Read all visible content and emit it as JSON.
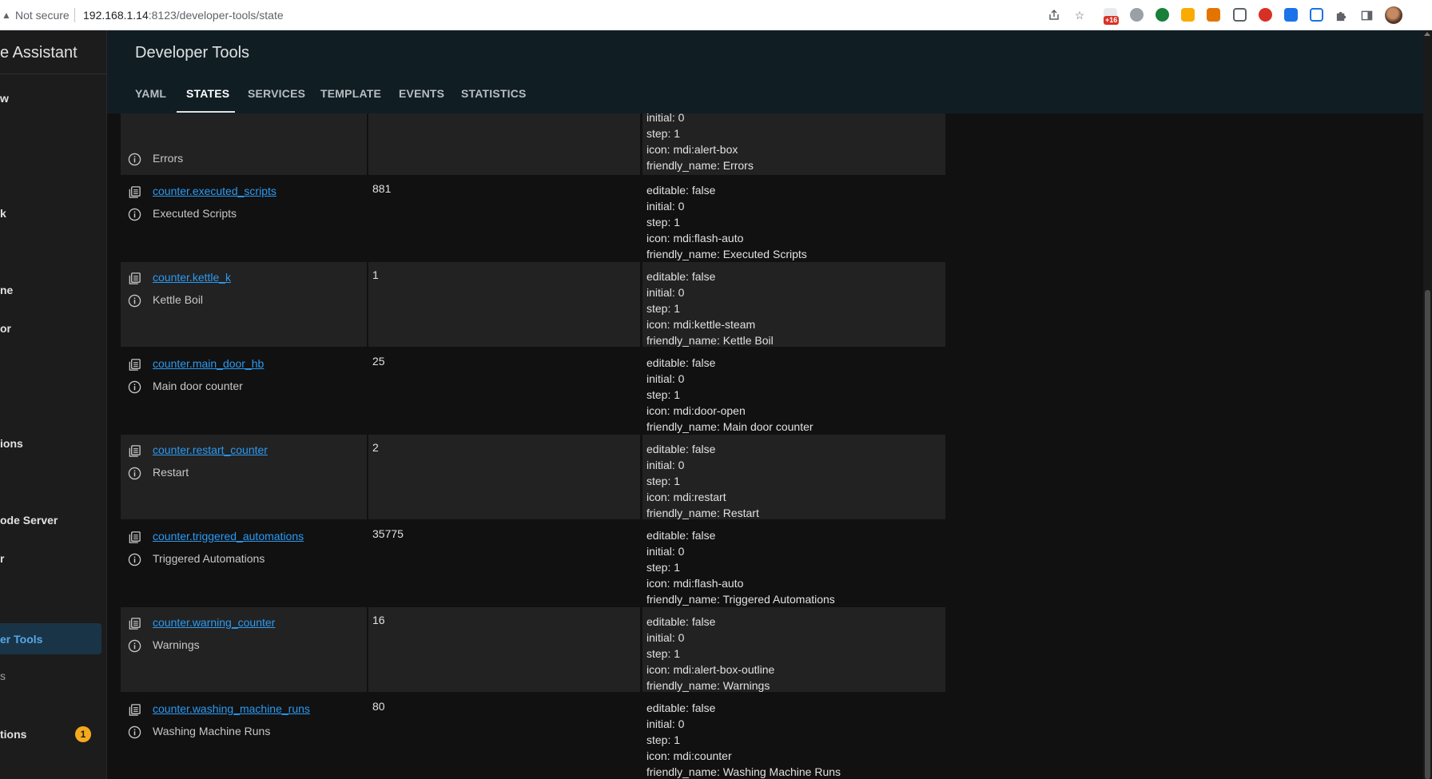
{
  "browser": {
    "security_label": "Not secure",
    "url_host": "192.168.1.14",
    "url_rest": ":8123/developer-tools/state",
    "ext_badge": "+16"
  },
  "sidebar": {
    "title": "e Assistant",
    "items": [
      "w",
      "k",
      "ne",
      "or",
      "ions",
      "ode Server",
      "r",
      "s",
      "tions"
    ],
    "active_label": "er Tools",
    "badge": "1"
  },
  "header": {
    "title": "Developer Tools",
    "tabs": [
      "YAML",
      "STATES",
      "SERVICES",
      "TEMPLATE",
      "EVENTS",
      "STATISTICS"
    ],
    "active_tab": "STATES"
  },
  "partial_row": {
    "friendly": "Errors",
    "attrs": [
      "initial: 0",
      "step: 1",
      "icon: mdi:alert-box",
      "friendly_name: Errors"
    ]
  },
  "rows": [
    {
      "entity": "counter.executed_scripts",
      "friendly": "Executed Scripts",
      "state": "881",
      "attrs": [
        "editable: false",
        "initial: 0",
        "step: 1",
        "icon: mdi:flash-auto",
        "friendly_name: Executed Scripts"
      ]
    },
    {
      "entity": "counter.kettle_k",
      "friendly": "Kettle Boil",
      "state": "1",
      "attrs": [
        "editable: false",
        "initial: 0",
        "step: 1",
        "icon: mdi:kettle-steam",
        "friendly_name: Kettle Boil"
      ]
    },
    {
      "entity": "counter.main_door_hb",
      "friendly": "Main door counter",
      "state": "25",
      "attrs": [
        "editable: false",
        "initial: 0",
        "step: 1",
        "icon: mdi:door-open",
        "friendly_name: Main door counter"
      ]
    },
    {
      "entity": "counter.restart_counter",
      "friendly": "Restart",
      "state": "2",
      "attrs": [
        "editable: false",
        "initial: 0",
        "step: 1",
        "icon: mdi:restart",
        "friendly_name: Restart"
      ]
    },
    {
      "entity": "counter.triggered_automations",
      "friendly": "Triggered Automations",
      "state": "35775",
      "attrs": [
        "editable: false",
        "initial: 0",
        "step: 1",
        "icon: mdi:flash-auto",
        "friendly_name: Triggered Automations"
      ]
    },
    {
      "entity": "counter.warning_counter",
      "friendly": "Warnings",
      "state": "16",
      "attrs": [
        "editable: false",
        "initial: 0",
        "step: 1",
        "icon: mdi:alert-box-outline",
        "friendly_name: Warnings"
      ]
    },
    {
      "entity": "counter.washing_machine_runs",
      "friendly": "Washing Machine Runs",
      "state": "80",
      "attrs": [
        "editable: false",
        "initial: 0",
        "step: 1",
        "icon: mdi:counter",
        "friendly_name: Washing Machine Runs"
      ]
    }
  ],
  "colors": {
    "accent_link": "#2b9af3",
    "header_bg": "#101e24",
    "badge": "#f4a91d"
  }
}
